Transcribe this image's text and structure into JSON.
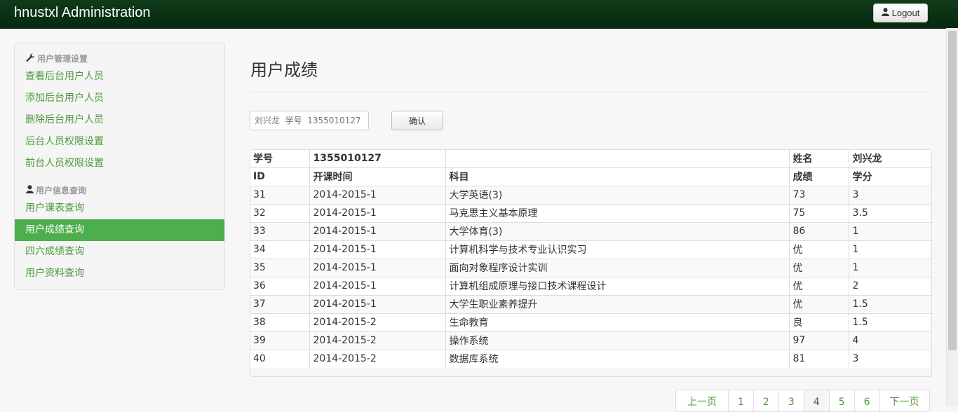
{
  "navbar": {
    "brand": "hnustxl Administration",
    "logout_label": "Logout",
    "logout_icon": "user-icon"
  },
  "sidebar": {
    "group1": {
      "icon": "wrench-icon",
      "label": "用户管理设置"
    },
    "group1_items": [
      "查看后台用户人员",
      "添加后台用户人员",
      "删除后台用户人员",
      "后台人员权限设置",
      "前台人员权限设置"
    ],
    "group2": {
      "icon": "user-icon",
      "label": "用户信息查询"
    },
    "group2_items": [
      "用户课表查询",
      "用户成绩查询",
      "四六成绩查询",
      "用户资料查询"
    ],
    "active_item": "用户成绩查询"
  },
  "main": {
    "title": "用户成绩",
    "search_placeholder": "刘兴龙  学号  1355010127",
    "confirm_label": "确认"
  },
  "grades": {
    "info_row": {
      "id_label": "学号",
      "id_value": "1355010127",
      "name_label": "姓名",
      "name_value": "刘兴龙"
    },
    "columns": [
      "ID",
      "开课时间",
      "科目",
      "成绩",
      "学分"
    ],
    "rows": [
      [
        "31",
        "2014-2015-1",
        "大学英语(3)",
        "73",
        "3"
      ],
      [
        "32",
        "2014-2015-1",
        "马克思主义基本原理",
        "75",
        "3.5"
      ],
      [
        "33",
        "2014-2015-1",
        "大学体育(3)",
        "86",
        "1"
      ],
      [
        "34",
        "2014-2015-1",
        "计算机科学与技术专业认识实习",
        "优",
        "1"
      ],
      [
        "35",
        "2014-2015-1",
        "面向对象程序设计实训",
        "优",
        "1"
      ],
      [
        "36",
        "2014-2015-1",
        "计算机组成原理与接口技术课程设计",
        "优",
        "2"
      ],
      [
        "37",
        "2014-2015-1",
        "大学生职业素养提升",
        "优",
        "1.5"
      ],
      [
        "38",
        "2014-2015-2",
        "生命教育",
        "良",
        "1.5"
      ],
      [
        "39",
        "2014-2015-2",
        "操作系统",
        "97",
        "4"
      ],
      [
        "40",
        "2014-2015-2",
        "数据库系统",
        "81",
        "3"
      ]
    ]
  },
  "pagination": {
    "prev_label": "上一页",
    "pages": [
      "1",
      "2",
      "3",
      "4",
      "5",
      "6"
    ],
    "current": "4",
    "next_label": "下一页"
  },
  "colors": {
    "navbar": "#0f3b19",
    "accent": "#4cae4c",
    "link": "#4a9a3b"
  }
}
